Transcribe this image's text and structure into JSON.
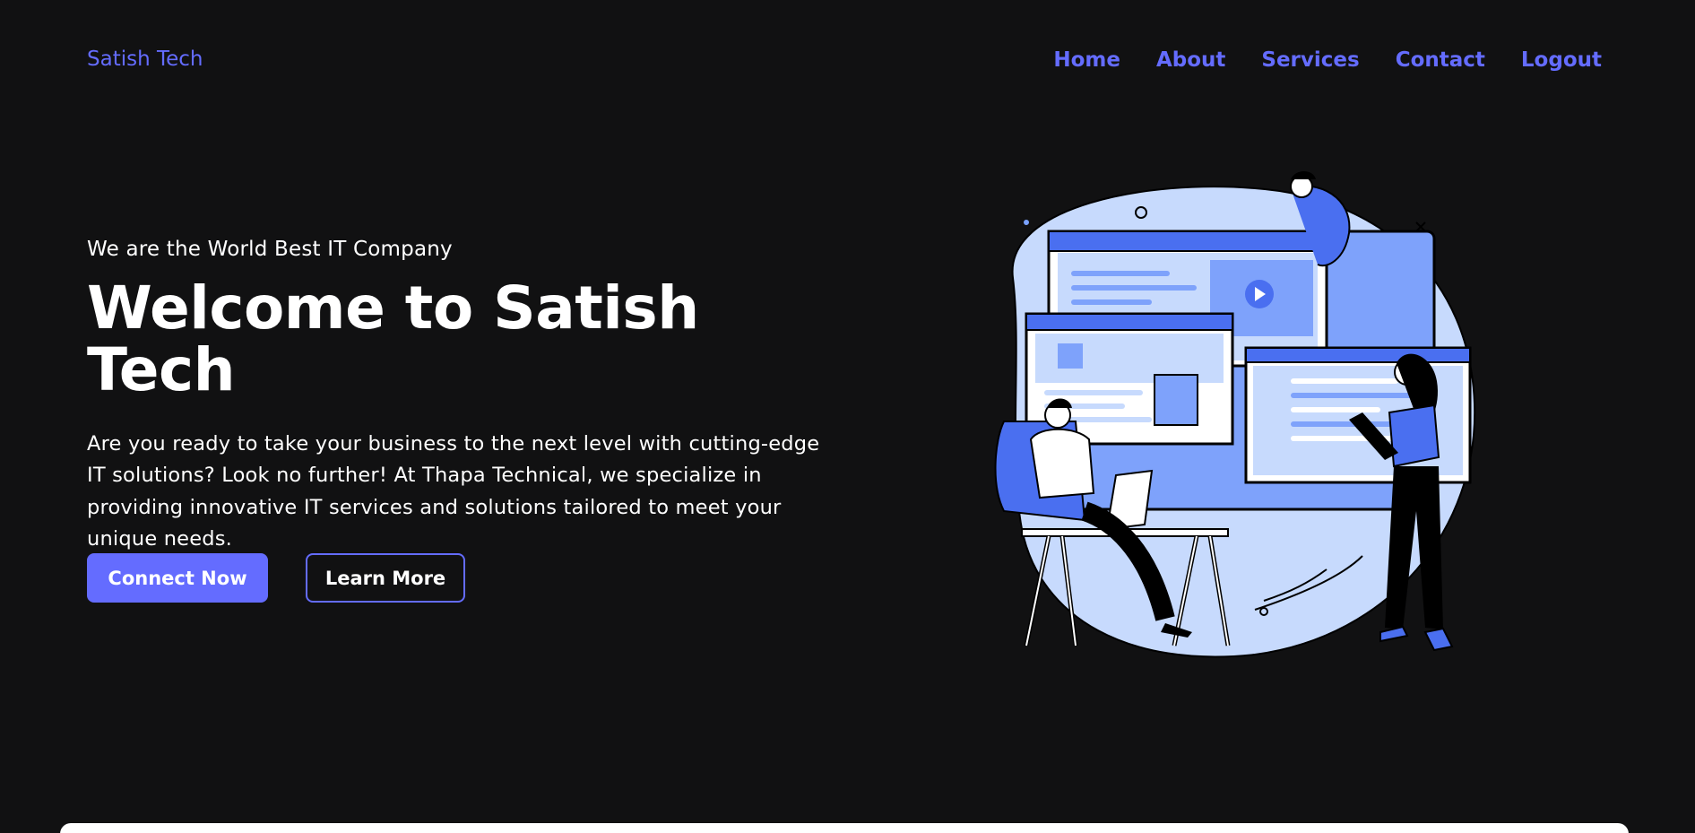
{
  "header": {
    "logo": "Satish Tech",
    "nav": [
      "Home",
      "About",
      "Services",
      "Contact",
      "Logout"
    ]
  },
  "hero": {
    "tagline": "We are the World Best IT Company",
    "title": "Welcome to Satish Tech",
    "description": "Are you ready to take your business to the next level with cutting-edge IT solutions? Look no further! At Thapa Technical, we specialize in providing innovative IT services and solutions tailored to meet your unique needs.",
    "primary_button": "Connect Now",
    "secondary_button": "Learn More"
  },
  "colors": {
    "background": "#111112",
    "accent": "#646cff",
    "text": "#ffffff"
  }
}
